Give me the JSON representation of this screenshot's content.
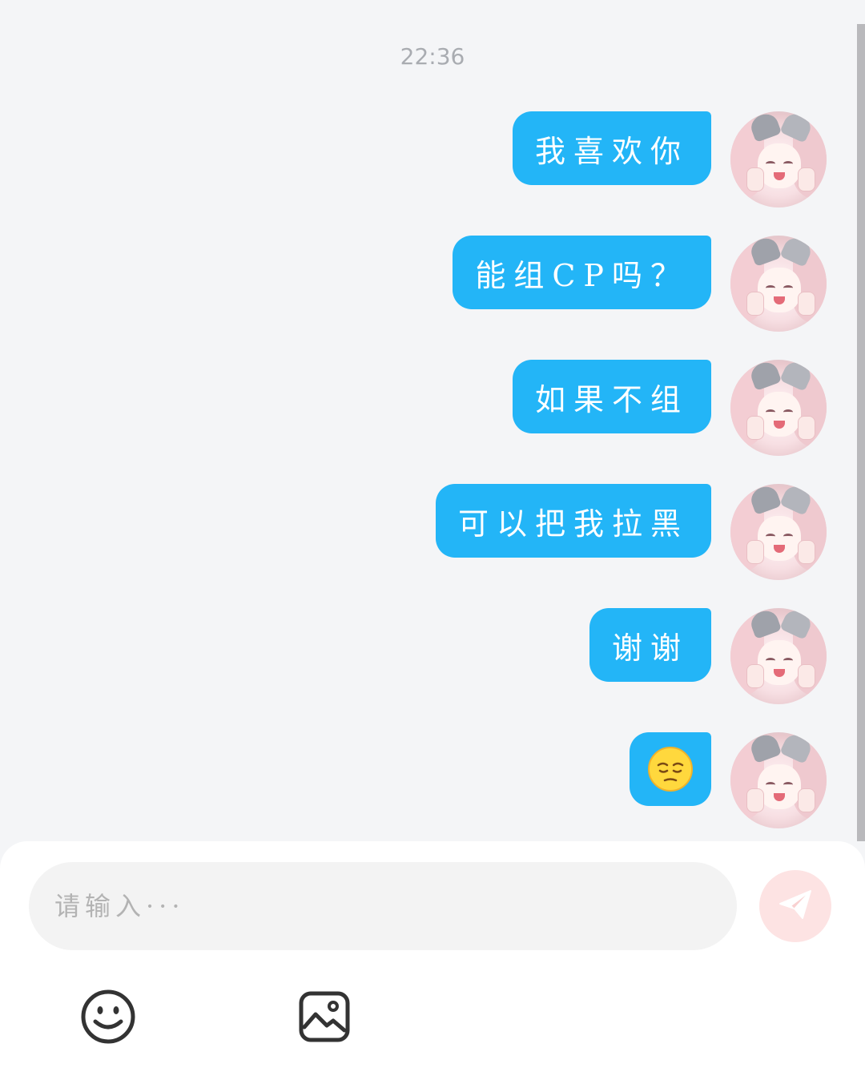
{
  "timestamp": "22:36",
  "messages": [
    {
      "text": "我喜欢你"
    },
    {
      "text": "能组CP吗？"
    },
    {
      "text": "如果不组"
    },
    {
      "text": "可以把我拉黑"
    },
    {
      "text": "谢谢"
    },
    {
      "text": "😔"
    }
  ],
  "input": {
    "placeholder": "请输入···",
    "value": ""
  },
  "toolbar": {
    "emoji_icon": "smiley-face-icon",
    "image_icon": "image-picture-icon",
    "send_icon": "paper-plane-send-icon"
  },
  "colors": {
    "bubble": "#23b5f7",
    "background": "#f4f5f7",
    "send_button": "#fde3e3"
  }
}
